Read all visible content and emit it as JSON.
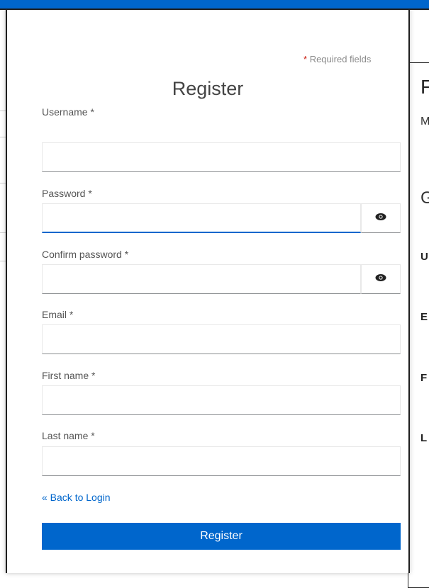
{
  "dialog": {
    "required_star": "*",
    "required_text": "Required fields",
    "title": "Register",
    "fields": [
      {
        "label": "Username *",
        "value": "",
        "placeholder": ""
      },
      {
        "label": "Password *",
        "value": "",
        "placeholder": ""
      },
      {
        "label": "Confirm password *",
        "value": "",
        "placeholder": ""
      },
      {
        "label": "Email *",
        "value": "",
        "placeholder": ""
      },
      {
        "label": "First name *",
        "value": "",
        "placeholder": ""
      },
      {
        "label": "Last name *",
        "value": "",
        "placeholder": ""
      }
    ],
    "back_link": "« Back to Login",
    "register_button": "Register",
    "show_password_icon": "eye-icon"
  },
  "background_right": {
    "heading": "F",
    "subtext": "M",
    "section": "G",
    "labels": [
      "U",
      "E",
      "F",
      "L"
    ]
  },
  "colors": {
    "primary": "#0066cc",
    "required_star": "#c9190b",
    "label_text": "#555555"
  }
}
